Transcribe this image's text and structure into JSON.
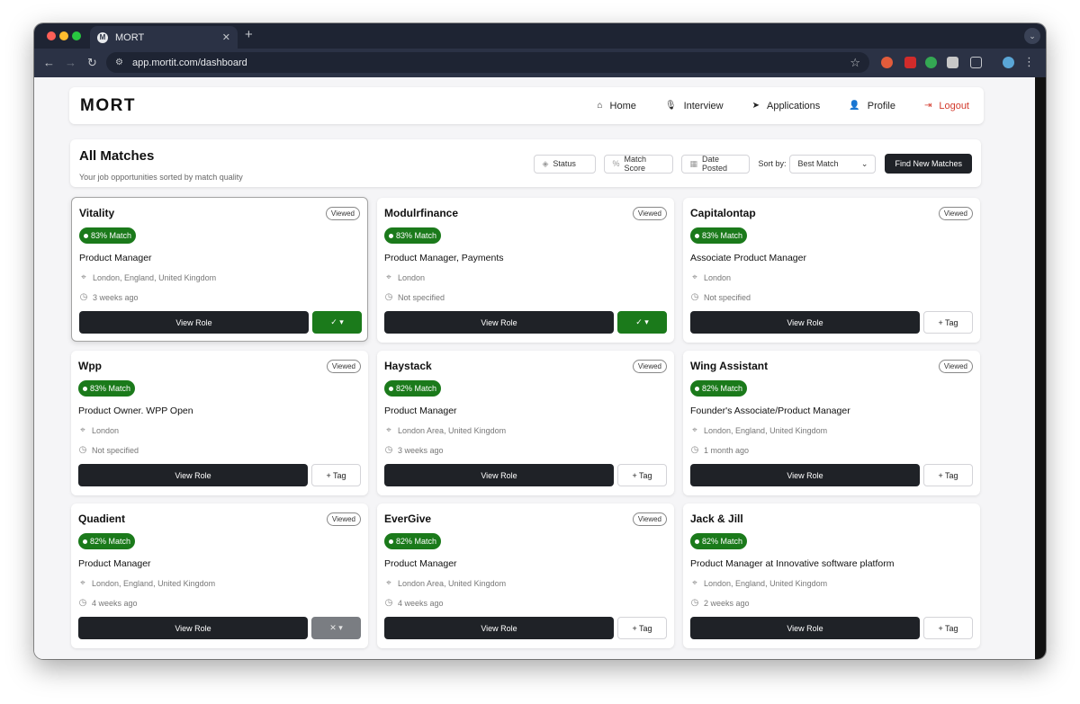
{
  "browser": {
    "tab_title": "MORT",
    "tab_favicon": "M",
    "url": "app.mortit.com/dashboard"
  },
  "nav": {
    "brand": "MORT",
    "links": [
      {
        "label": "Home",
        "icon": "home-icon",
        "glyph": "⌂"
      },
      {
        "label": "Interview",
        "icon": "microphone-icon",
        "glyph": "🎙"
      },
      {
        "label": "Applications",
        "icon": "paper-plane-icon",
        "glyph": "➤"
      },
      {
        "label": "Profile",
        "icon": "user-icon",
        "glyph": "👤"
      }
    ],
    "logout_label": "Logout"
  },
  "header": {
    "title": "All Matches",
    "subtitle": "Your job opportunities sorted by match quality",
    "filters": {
      "status": "Status",
      "match_score": "Match Score",
      "date_posted": "Date Posted"
    },
    "sort_label": "Sort by:",
    "sort_value": "Best Match",
    "find_button": "Find New Matches"
  },
  "labels": {
    "viewed": "Viewed",
    "view_role": "View Role",
    "tag": "+ Tag",
    "accepted": "✓ ▾",
    "rejected": "✕ ▾"
  },
  "colors": {
    "match_green": "#1b7a1b",
    "logout_red": "#d33a2c",
    "dark_button": "#1f2227"
  },
  "jobs": [
    {
      "company": "Vitality",
      "viewed": true,
      "match": "83% Match",
      "title": "Product Manager",
      "location": "London, England, United Kingdom",
      "posted": "3 weeks ago",
      "tag_state": "accepted"
    },
    {
      "company": "Modulrfinance",
      "viewed": true,
      "match": "83% Match",
      "title": "Product Manager, Payments",
      "location": "London",
      "posted": "Not specified",
      "tag_state": "accepted"
    },
    {
      "company": "Capitalontap",
      "viewed": true,
      "match": "83% Match",
      "title": "Associate Product Manager",
      "location": "London",
      "posted": "Not specified",
      "tag_state": "none"
    },
    {
      "company": "Wpp",
      "viewed": true,
      "match": "83% Match",
      "title": "Product Owner. WPP Open",
      "location": "London",
      "posted": "Not specified",
      "tag_state": "none"
    },
    {
      "company": "Haystack",
      "viewed": true,
      "match": "82% Match",
      "title": "Product Manager",
      "location": "London Area, United Kingdom",
      "posted": "3 weeks ago",
      "tag_state": "none"
    },
    {
      "company": "Wing Assistant",
      "viewed": true,
      "match": "82% Match",
      "title": "Founder's Associate/Product Manager",
      "location": "London, England, United Kingdom",
      "posted": "1 month ago",
      "tag_state": "none"
    },
    {
      "company": "Quadient",
      "viewed": true,
      "match": "82% Match",
      "title": "Product Manager",
      "location": "London, England, United Kingdom",
      "posted": "4 weeks ago",
      "tag_state": "rejected"
    },
    {
      "company": "EverGive",
      "viewed": true,
      "match": "82% Match",
      "title": "Product Manager",
      "location": "London Area, United Kingdom",
      "posted": "4 weeks ago",
      "tag_state": "none"
    },
    {
      "company": "Jack & Jill",
      "viewed": false,
      "match": "82% Match",
      "title": "Product Manager at Innovative software platform",
      "location": "London, England, United Kingdom",
      "posted": "2 weeks ago",
      "tag_state": "none"
    }
  ]
}
